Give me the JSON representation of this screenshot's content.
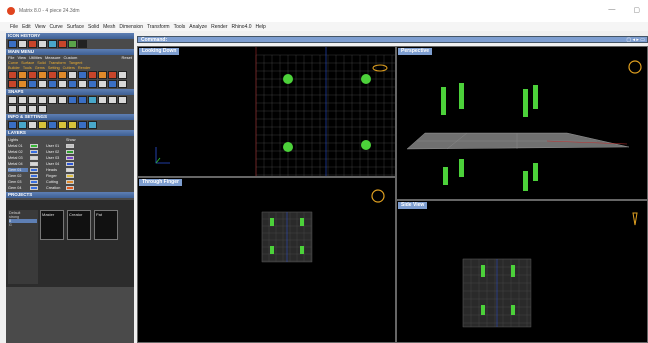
{
  "window": {
    "title": "Matrix 8.0 - 4 piece 24.3dm",
    "minimize": "—",
    "maximize": "▢"
  },
  "menu": [
    "File",
    "Edit",
    "View",
    "Curve",
    "Surface",
    "Solid",
    "Mesh",
    "Dimension",
    "Transform",
    "Tools",
    "Analyze",
    "Render",
    "Rhino4.0",
    "Help"
  ],
  "left_panel": {
    "icon_history_title": "ICON HISTORY",
    "main_menu_title": "MAIN MENU",
    "main_menu_items": [
      "File",
      "View",
      "Utilities",
      "Measure",
      "Custom"
    ],
    "main_menu_reset": "Reset",
    "tool_line1": [
      "Curve",
      "Surface",
      "Solid",
      "Transform",
      "Tangent"
    ],
    "tool_line2": [
      "Builder",
      "Tools",
      "Gems",
      "Setting",
      "Cutters",
      "Render"
    ],
    "snaps_title": "SNAPS",
    "info_title": "INFO & SETTINGS",
    "layers_title": "LAYERS",
    "layers_header": [
      "Lights",
      "Show"
    ],
    "layers": [
      {
        "name": "Metal 01",
        "color": "#38b838",
        "name2": "User 01",
        "color2": "#c0c0c0"
      },
      {
        "name": "Metal 02",
        "color": "#3a6fe0",
        "name2": "User 02",
        "color2": "#30a030"
      },
      {
        "name": "Metal 03",
        "color": "#d8d8d8",
        "name2": "User 03",
        "color2": "#7b48c8"
      },
      {
        "name": "Metal 04",
        "color": "#d8d8d8",
        "name2": "User 04",
        "color2": "#2a55d8"
      },
      {
        "name": "Gem 01",
        "color": "#3a6fe0",
        "name2": "Heads",
        "color2": "#d8d8d8"
      },
      {
        "name": "Gem 02",
        "color": "#3a6fe0",
        "name2": "Finger",
        "color2": "#e0c040"
      },
      {
        "name": "Gem 03",
        "color": "#3a6fe0",
        "name2": "Cutting",
        "color2": "#e08a2a"
      },
      {
        "name": "Gem 04",
        "color": "#3a6fe0",
        "name2": "Creation",
        "color2": "#e05a20"
      }
    ],
    "projects_title": "PROJECTS",
    "project_list": [
      "Default",
      "strong",
      "0",
      "G"
    ],
    "thumbs": [
      "Master",
      "Creator",
      "Pat"
    ]
  },
  "command": {
    "label": "Command:",
    "controls": "▢ ◂ ▸ ▭"
  },
  "viewports": {
    "top": "Looking Down",
    "perspective": "Perspective",
    "finger": "Through Finger",
    "side": "Side View"
  },
  "colors": {
    "accent": "#7e9ed0",
    "gem_green": "#4cd13a",
    "grid": "#4a4a4a",
    "ring_gold": "#e0a020"
  }
}
